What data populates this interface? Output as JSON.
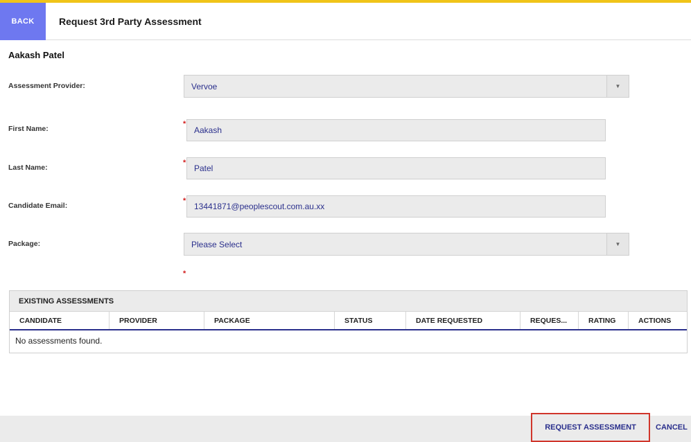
{
  "header": {
    "back_label": "BACK",
    "title": "Request 3rd Party Assessment"
  },
  "candidate_name": "Aakash Patel",
  "form": {
    "provider": {
      "label": "Assessment Provider:",
      "value": "Vervoe"
    },
    "first_name": {
      "label": "First Name:",
      "value": "Aakash"
    },
    "last_name": {
      "label": "Last Name:",
      "value": "Patel"
    },
    "email": {
      "label": "Candidate Email:",
      "value": "13441871@peoplescout.com.au.xx"
    },
    "package": {
      "label": "Package:",
      "value": "Please Select"
    },
    "required_mark": "*"
  },
  "assessments": {
    "title": "EXISTING ASSESSMENTS",
    "columns": [
      "CANDIDATE",
      "PROVIDER",
      "PACKAGE",
      "STATUS",
      "DATE REQUESTED",
      "REQUES...",
      "RATING",
      "ACTIONS"
    ],
    "empty_text": "No assessments found."
  },
  "footer": {
    "request_label": "REQUEST ASSESSMENT",
    "cancel_label": "CANCEL"
  },
  "colors": {
    "accent": "#6e78f0",
    "link": "#2a2f8c",
    "required": "#d21f1f",
    "highlight_border": "#d0352b",
    "top_line": "#f0c419"
  }
}
